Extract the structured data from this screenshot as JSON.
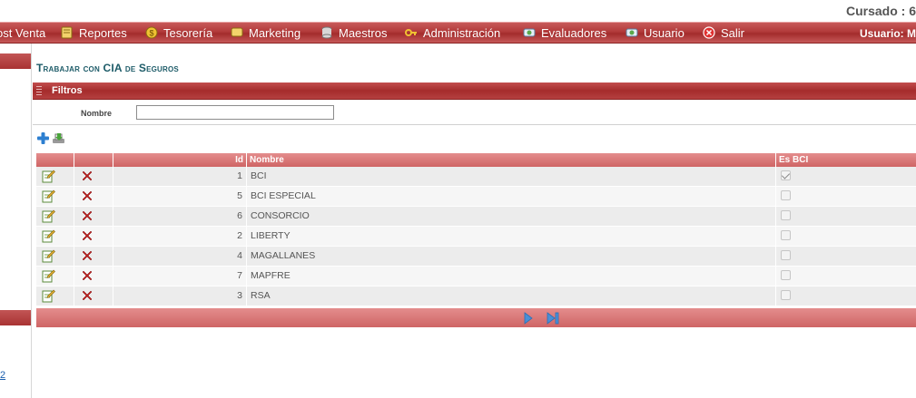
{
  "header": {
    "company": "Cursado : 6"
  },
  "menu": {
    "items": [
      {
        "label": "ost Venta",
        "icon": "post-sale-icon"
      },
      {
        "label": "Reportes",
        "icon": "reports-icon"
      },
      {
        "label": "Tesorería",
        "icon": "treasury-coin-icon"
      },
      {
        "label": "Marketing",
        "icon": "marketing-icon"
      },
      {
        "label": "Maestros",
        "icon": "database-icon"
      },
      {
        "label": "Administración",
        "icon": "key-icon"
      },
      {
        "label": "Evaluadores",
        "icon": "evaluators-icon"
      },
      {
        "label": "Usuario",
        "icon": "user-icon"
      },
      {
        "label": "Salir",
        "icon": "exit-icon"
      }
    ],
    "user_label": "Usuario: M"
  },
  "sidebar": {
    "link_text": "2"
  },
  "page": {
    "title": "Trabajar con CIA de Seguros"
  },
  "filters": {
    "title": "Filtros",
    "nombre_label": "Nombre",
    "nombre_value": ""
  },
  "toolbar": {
    "add_icon": "add-icon",
    "export_icon": "export-icon"
  },
  "grid": {
    "columns": {
      "id": "Id",
      "nombre": "Nombre",
      "es_bci": "Es BCI"
    },
    "rows": [
      {
        "id": "1",
        "nombre": "BCI",
        "es_bci": true
      },
      {
        "id": "5",
        "nombre": "BCI ESPECIAL",
        "es_bci": false
      },
      {
        "id": "6",
        "nombre": "CONSORCIO",
        "es_bci": false
      },
      {
        "id": "2",
        "nombre": "LIBERTY",
        "es_bci": false
      },
      {
        "id": "4",
        "nombre": "MAGALLANES",
        "es_bci": false
      },
      {
        "id": "7",
        "nombre": "MAPFRE",
        "es_bci": false
      },
      {
        "id": "3",
        "nombre": "RSA",
        "es_bci": false
      }
    ]
  },
  "pager": {
    "next_icon": "next-page-icon",
    "last_icon": "last-page-icon"
  },
  "colors": {
    "menu_red": "#b23a3a",
    "header_pink": "#d97575",
    "title_teal": "#1d5b68"
  }
}
